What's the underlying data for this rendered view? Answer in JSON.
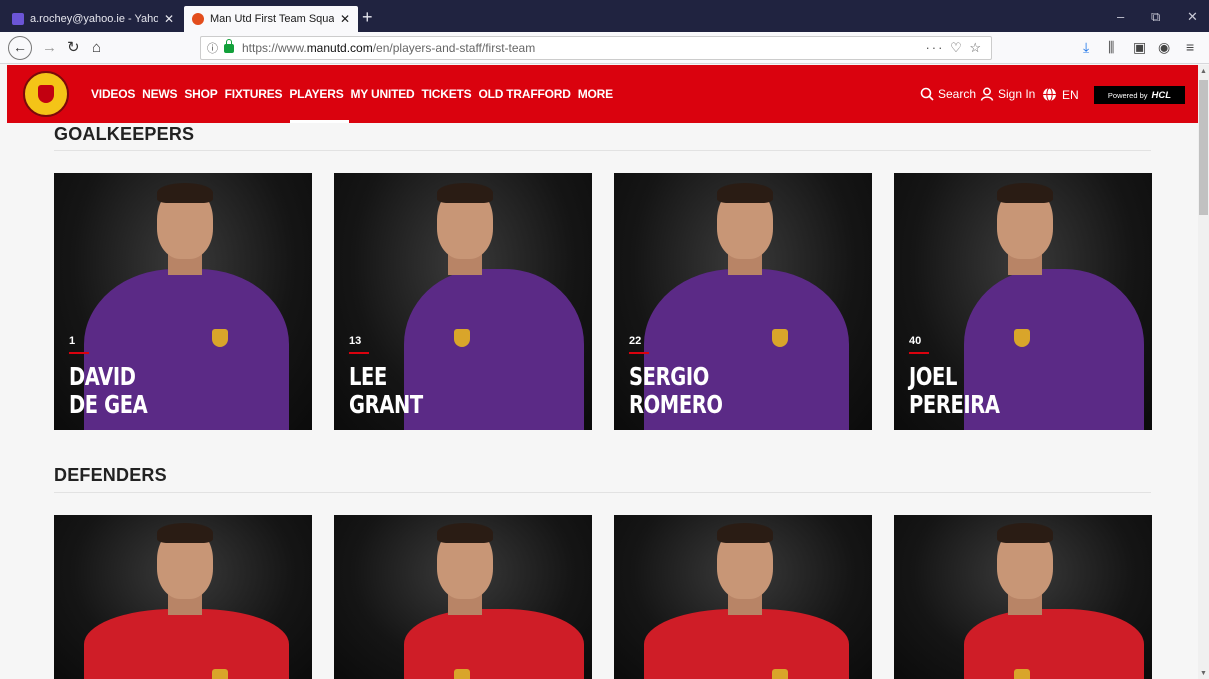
{
  "browser": {
    "tabs": [
      {
        "title": "a.rochey@yahoo.ie - Yahoo Ma",
        "active": false
      },
      {
        "title": "Man Utd First Team Squad & Pl",
        "active": true
      }
    ],
    "new_tab": "+",
    "close_glyph": "✕",
    "window_controls": {
      "minimize": "–",
      "restore": "⧉",
      "close": "✕"
    },
    "nav": {
      "back": "←",
      "forward": "→",
      "reload": "↻",
      "home": "⌂"
    },
    "url": {
      "prefix": "https://www.",
      "domain": "manutd.com",
      "path": "/en/players-and-staff/first-team"
    },
    "url_actions": "··· ♡ ☆",
    "toolbar_icons": {
      "download": "⤓",
      "library": "⫼",
      "sidebar": "▣",
      "account": "◉",
      "menu": "≡"
    }
  },
  "site": {
    "nav": [
      "VIDEOS",
      "NEWS",
      "SHOP",
      "FIXTURES",
      "PLAYERS",
      "MY UNITED",
      "TICKETS",
      "OLD TRAFFORD",
      "MORE"
    ],
    "active_nav": "PLAYERS",
    "search_label": "Search",
    "signin_label": "Sign In",
    "language": "EN",
    "powered_by": "Powered by",
    "powered_brand": "HCL",
    "brand_color": "#da020e"
  },
  "sections": [
    {
      "title": "GOALKEEPERS",
      "players": [
        {
          "number": "1",
          "first": "DAVID",
          "last": "DE GEA",
          "kit": "purple"
        },
        {
          "number": "13",
          "first": "LEE",
          "last": "GRANT",
          "kit": "purple"
        },
        {
          "number": "22",
          "first": "SERGIO",
          "last": "ROMERO",
          "kit": "purple"
        },
        {
          "number": "40",
          "first": "JOEL",
          "last": "PEREIRA",
          "kit": "purple"
        }
      ]
    },
    {
      "title": "DEFENDERS",
      "players": [
        {
          "number": "",
          "first": "",
          "last": "",
          "kit": "red"
        },
        {
          "number": "",
          "first": "",
          "last": "",
          "kit": "red"
        },
        {
          "number": "",
          "first": "",
          "last": "",
          "kit": "red"
        },
        {
          "number": "",
          "first": "",
          "last": "",
          "kit": "red"
        }
      ]
    }
  ]
}
